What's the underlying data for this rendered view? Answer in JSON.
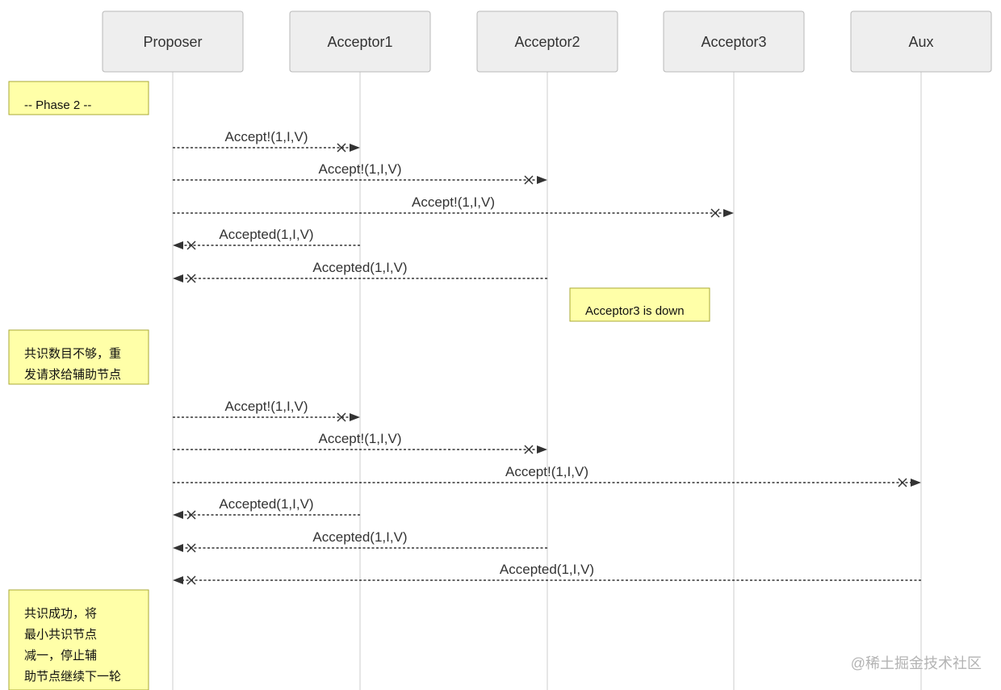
{
  "actors": [
    {
      "id": "proposer",
      "label": "Proposer"
    },
    {
      "id": "acceptor1",
      "label": "Acceptor1"
    },
    {
      "id": "acceptor2",
      "label": "Acceptor2"
    },
    {
      "id": "acceptor3",
      "label": "Acceptor3"
    },
    {
      "id": "aux",
      "label": "Aux"
    }
  ],
  "notes": [
    {
      "id": "phase2",
      "lines": [
        "-- Phase 2 --"
      ]
    },
    {
      "id": "acceptor3-down",
      "lines": [
        "Acceptor3 is down"
      ]
    },
    {
      "id": "retry-aux",
      "lines": [
        "共识数目不够，重",
        "发请求给辅助节点"
      ]
    },
    {
      "id": "success",
      "lines": [
        "共识成功，将",
        "最小共识节点",
        "减一，停止辅",
        "助节点继续下一轮"
      ]
    }
  ],
  "messages": [
    {
      "from": "proposer",
      "to": "acceptor1",
      "label": "Accept!(1,I,V)"
    },
    {
      "from": "proposer",
      "to": "acceptor2",
      "label": "Accept!(1,I,V)"
    },
    {
      "from": "proposer",
      "to": "acceptor3",
      "label": "Accept!(1,I,V)"
    },
    {
      "from": "acceptor1",
      "to": "proposer",
      "label": "Accepted(1,I,V)"
    },
    {
      "from": "acceptor2",
      "to": "proposer",
      "label": "Accepted(1,I,V)"
    },
    {
      "from": "proposer",
      "to": "acceptor1",
      "label": "Accept!(1,I,V)"
    },
    {
      "from": "proposer",
      "to": "acceptor2",
      "label": "Accept!(1,I,V)"
    },
    {
      "from": "proposer",
      "to": "aux",
      "label": "Accept!(1,I,V)"
    },
    {
      "from": "acceptor1",
      "to": "proposer",
      "label": "Accepted(1,I,V)"
    },
    {
      "from": "acceptor2",
      "to": "proposer",
      "label": "Accepted(1,I,V)"
    },
    {
      "from": "aux",
      "to": "proposer",
      "label": "Accepted(1,I,V)"
    }
  ],
  "watermark": "@稀土掘金技术社区"
}
